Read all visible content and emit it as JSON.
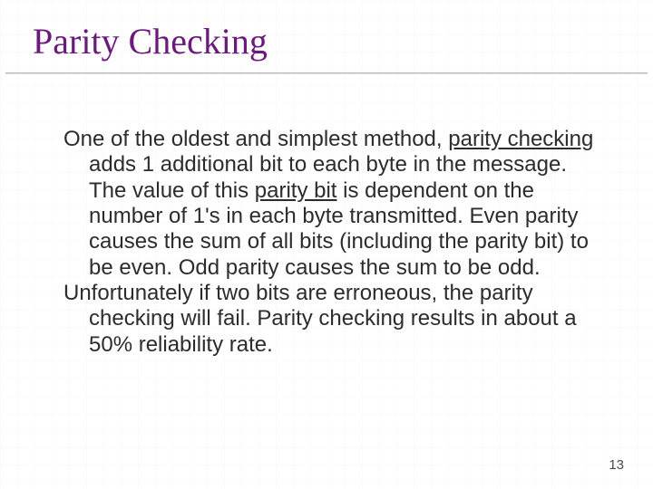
{
  "title": "Parity Checking",
  "body": {
    "p1_a": "One of the oldest and simplest method, ",
    "p1_u1": "parity checking",
    "p1_b": " adds 1 additional bit to each byte in the message.  The value of this ",
    "p1_u2": "parity bit",
    "p1_c": " is dependent on the number of 1's in each byte transmitted.  Even parity causes the sum of all bits (including the parity bit) to be even.  Odd parity causes the sum to be odd.",
    "p2": "Unfortunately if two bits are erroneous, the parity checking will fail. Parity checking results in about a 50% reliability rate."
  },
  "page_number": "13"
}
